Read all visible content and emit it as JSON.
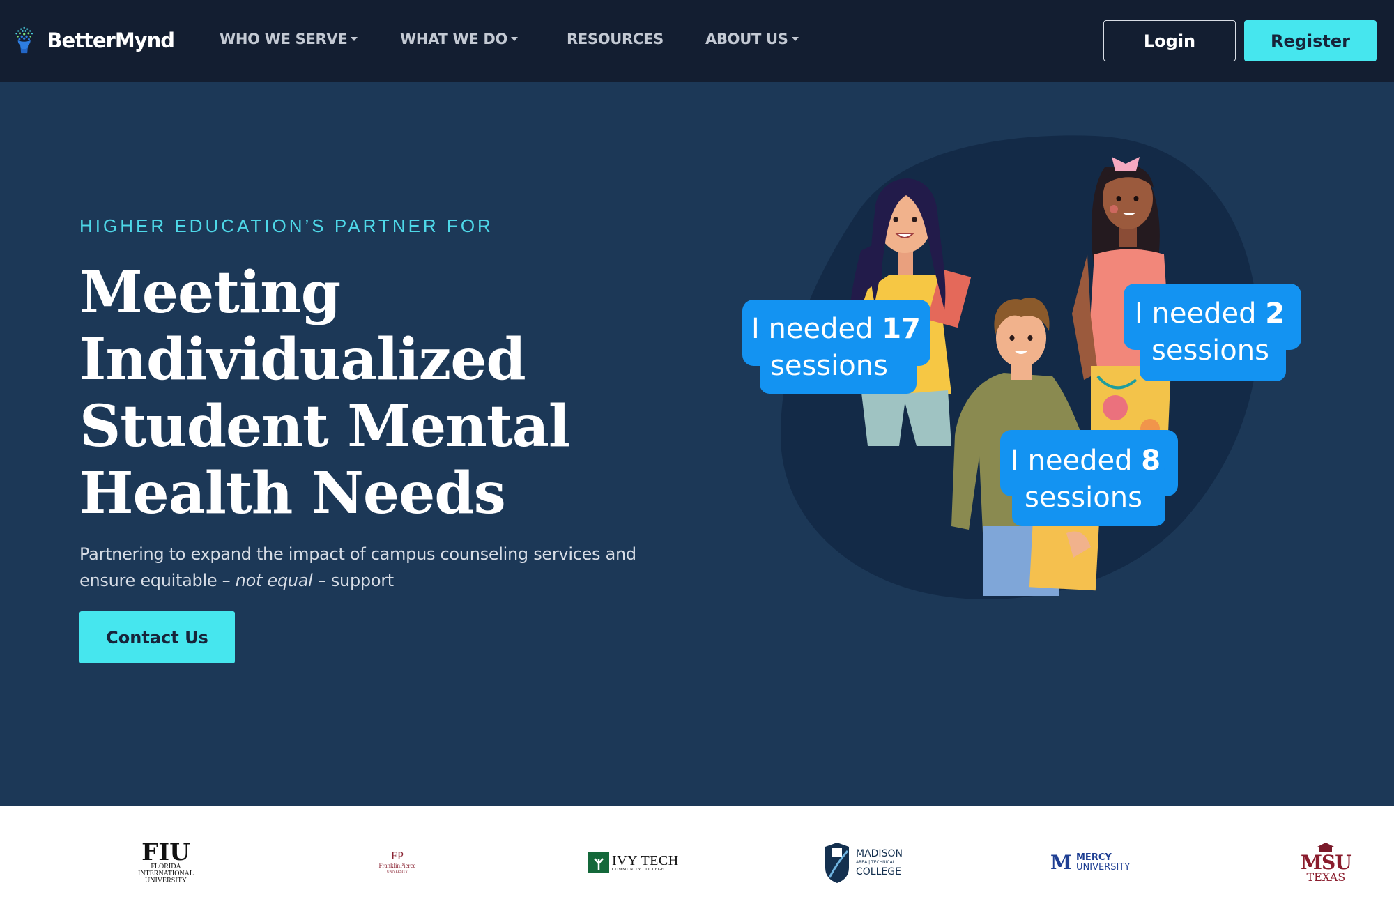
{
  "brand": {
    "name": "BetterMynd"
  },
  "nav": {
    "items": [
      {
        "label": "WHO WE SERVE",
        "dropdown": true
      },
      {
        "label": "WHAT WE DO",
        "dropdown": true
      },
      {
        "label": "RESOURCES",
        "dropdown": false
      },
      {
        "label": "ABOUT US",
        "dropdown": true
      }
    ],
    "login_label": "Login",
    "register_label": "Register"
  },
  "hero": {
    "eyebrow": "HIGHER EDUCATION’S PARTNER FOR",
    "headline_lines": [
      "Meeting",
      "Individualized",
      "Student Mental",
      "Health Needs"
    ],
    "subtitle_start": "Partnering to expand the impact of campus counseling services and ensure equitable – ",
    "subtitle_emphasis": "not equal",
    "subtitle_end": " – support",
    "cta_label": "Contact Us"
  },
  "bubbles": [
    {
      "prefix": "I needed ",
      "number": "17",
      "suffix": "sessions"
    },
    {
      "prefix": "I needed ",
      "number": "2",
      "suffix": "sessions"
    },
    {
      "prefix": "I needed ",
      "number": "8",
      "suffix": "sessions"
    }
  ],
  "partners": [
    {
      "abbr": "FIU",
      "name_lines": [
        "FLORIDA",
        "INTERNATIONAL",
        "UNIVERSITY"
      ]
    },
    {
      "abbr": "FP",
      "name_lines": [
        "FranklinPierce",
        "UNIVERSITY"
      ]
    },
    {
      "abbr": "IVY TECH",
      "name_lines": [
        "COMMUNITY COLLEGE"
      ]
    },
    {
      "abbr": "MADISON",
      "name_lines": [
        "AREA | TECHNICAL",
        "COLLEGE"
      ]
    },
    {
      "abbr": "MERCY",
      "name_lines": [
        "UNIVERSITY"
      ]
    },
    {
      "abbr": "MSU",
      "name_lines": [
        "TEXAS"
      ]
    }
  ],
  "colors": {
    "nav_bg": "#131e31",
    "hero_bg": "#1c3857",
    "accent": "#46e6ee",
    "bubble": "#1393f2"
  }
}
